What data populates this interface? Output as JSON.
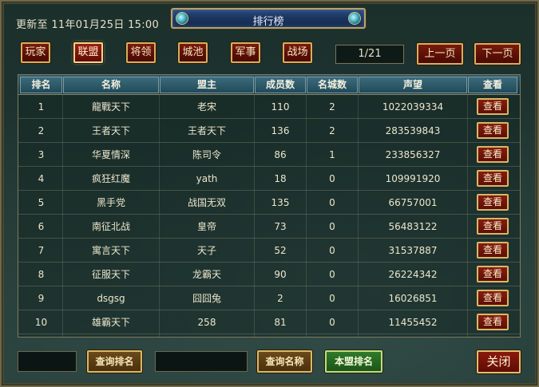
{
  "update": {
    "text": "更新至 11年01月25日 15:00"
  },
  "title": "排行榜",
  "tabs": [
    {
      "label": "玩家",
      "active": false
    },
    {
      "label": "联盟",
      "active": true
    },
    {
      "label": "将领",
      "active": false
    },
    {
      "label": "城池",
      "active": false
    },
    {
      "label": "军事",
      "active": false
    },
    {
      "label": "战场",
      "active": false
    }
  ],
  "pager": {
    "indicator": "1/21",
    "prev_label": "上一页",
    "next_label": "下一页"
  },
  "table": {
    "headers": [
      "排名",
      "名称",
      "盟主",
      "成员数",
      "名城数",
      "声望",
      "查看"
    ],
    "view_label": "查看",
    "rows": [
      {
        "rank": "1",
        "name": "龍戰天下",
        "leader": "老宋",
        "members": "110",
        "cities": "2",
        "prestige": "1022039334"
      },
      {
        "rank": "2",
        "name": "王者天下",
        "leader": "王者天下",
        "members": "136",
        "cities": "2",
        "prestige": "283539843"
      },
      {
        "rank": "3",
        "name": "华夏情深",
        "leader": "陈司令",
        "members": "86",
        "cities": "1",
        "prestige": "233856327"
      },
      {
        "rank": "4",
        "name": "疯狂红魔",
        "leader": "yath",
        "members": "18",
        "cities": "0",
        "prestige": "109991920"
      },
      {
        "rank": "5",
        "name": "黑手党",
        "leader": "战国无双",
        "members": "135",
        "cities": "0",
        "prestige": "66757001"
      },
      {
        "rank": "6",
        "name": "南征北战",
        "leader": "皇帝",
        "members": "73",
        "cities": "0",
        "prestige": "56483122"
      },
      {
        "rank": "7",
        "name": "寓言天下",
        "leader": "天子",
        "members": "52",
        "cities": "0",
        "prestige": "31537887"
      },
      {
        "rank": "8",
        "name": "征服天下",
        "leader": "龙霸天",
        "members": "90",
        "cities": "0",
        "prestige": "26224342"
      },
      {
        "rank": "9",
        "name": "dsgsg",
        "leader": "囧囧兔",
        "members": "2",
        "cities": "0",
        "prestige": "16026851"
      },
      {
        "rank": "10",
        "name": "雄霸天下",
        "leader": "258",
        "members": "81",
        "cities": "0",
        "prestige": "11455452"
      }
    ]
  },
  "bottom": {
    "query_rank_label": "查询排名",
    "query_name_label": "查询名称",
    "my_alliance_label": "本盟排名",
    "close_label": "关闭"
  }
}
